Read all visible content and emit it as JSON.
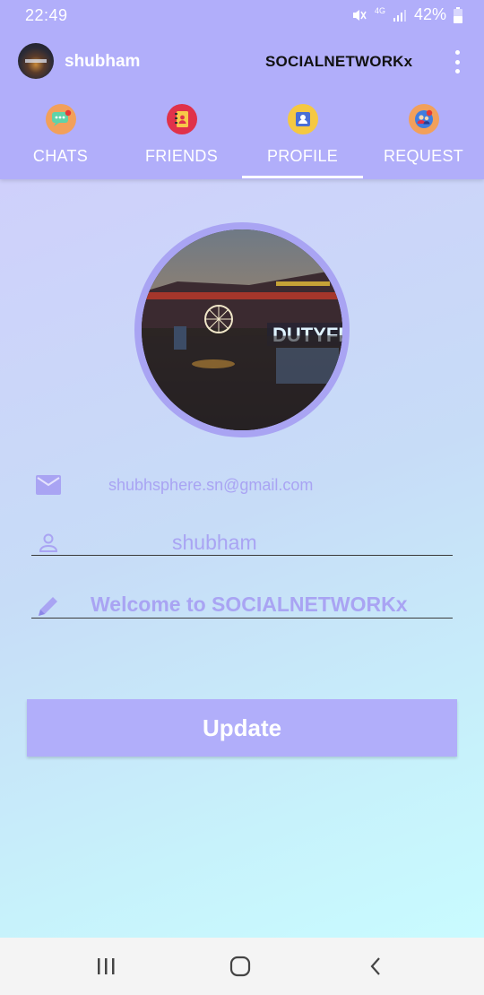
{
  "status_bar": {
    "time": "22:49",
    "network": "4G",
    "battery": "42%",
    "icons": [
      "mute-icon",
      "signal-icon",
      "battery-icon"
    ]
  },
  "app_bar": {
    "user_name": "shubham",
    "title": "SOCIALNETWORKx",
    "menu_icon": "more-vert-icon"
  },
  "tabs": [
    {
      "label": "CHATS",
      "icon": "chat-icon",
      "selected": false
    },
    {
      "label": "FRIENDS",
      "icon": "contacts-book-icon",
      "selected": false
    },
    {
      "label": "PROFILE",
      "icon": "profile-card-icon",
      "selected": true
    },
    {
      "label": "REQUEST",
      "icon": "friend-request-icon",
      "selected": false
    }
  ],
  "profile": {
    "email": "shubhsphere.sn@gmail.com",
    "name": "shubham",
    "status": "Welcome to SOCIALNETWORKx",
    "update_label": "Update"
  },
  "colors": {
    "accent": "#b1aefa",
    "text_accent": "#a9a4f3"
  },
  "nav": [
    "recent-apps-icon",
    "home-icon",
    "back-icon"
  ]
}
